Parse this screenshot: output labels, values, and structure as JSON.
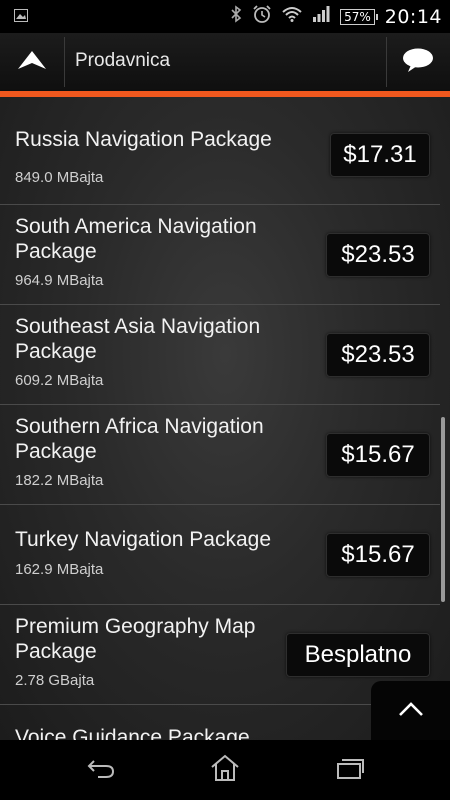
{
  "status_bar": {
    "battery": "57%",
    "time": "20:14",
    "icons": [
      "image-notification-icon",
      "bluetooth-icon",
      "alarm-clock-icon",
      "wifi-icon",
      "signal-icon",
      "battery-icon"
    ]
  },
  "action_bar": {
    "title": "Prodavnica",
    "icons": [
      "up-arrow-icon",
      "chat-bubble-icon"
    ]
  },
  "accent_color": "#f0581e",
  "packages": [
    {
      "name": "Russia Navigation Package",
      "size": "849.0 MBajta",
      "price": "$17.31"
    },
    {
      "name": "South America Navigation Package",
      "size": "964.9 MBajta",
      "price": "$23.53"
    },
    {
      "name": "Southeast Asia Navigation Package",
      "size": "609.2 MBajta",
      "price": "$23.53"
    },
    {
      "name": "Southern Africa Navigation Package",
      "size": "182.2 MBajta",
      "price": "$15.67"
    },
    {
      "name": "Turkey Navigation Package",
      "size": "162.9 MBajta",
      "price": "$15.67"
    },
    {
      "name": "Premium Geography Map Package",
      "size": "2.78 GBajta",
      "price": "Besplatno"
    },
    {
      "name": "Voice Guidance Package",
      "size": "",
      "price": ""
    }
  ],
  "nav_bar": {
    "icons": [
      "back-icon",
      "home-icon",
      "recent-apps-icon"
    ]
  }
}
